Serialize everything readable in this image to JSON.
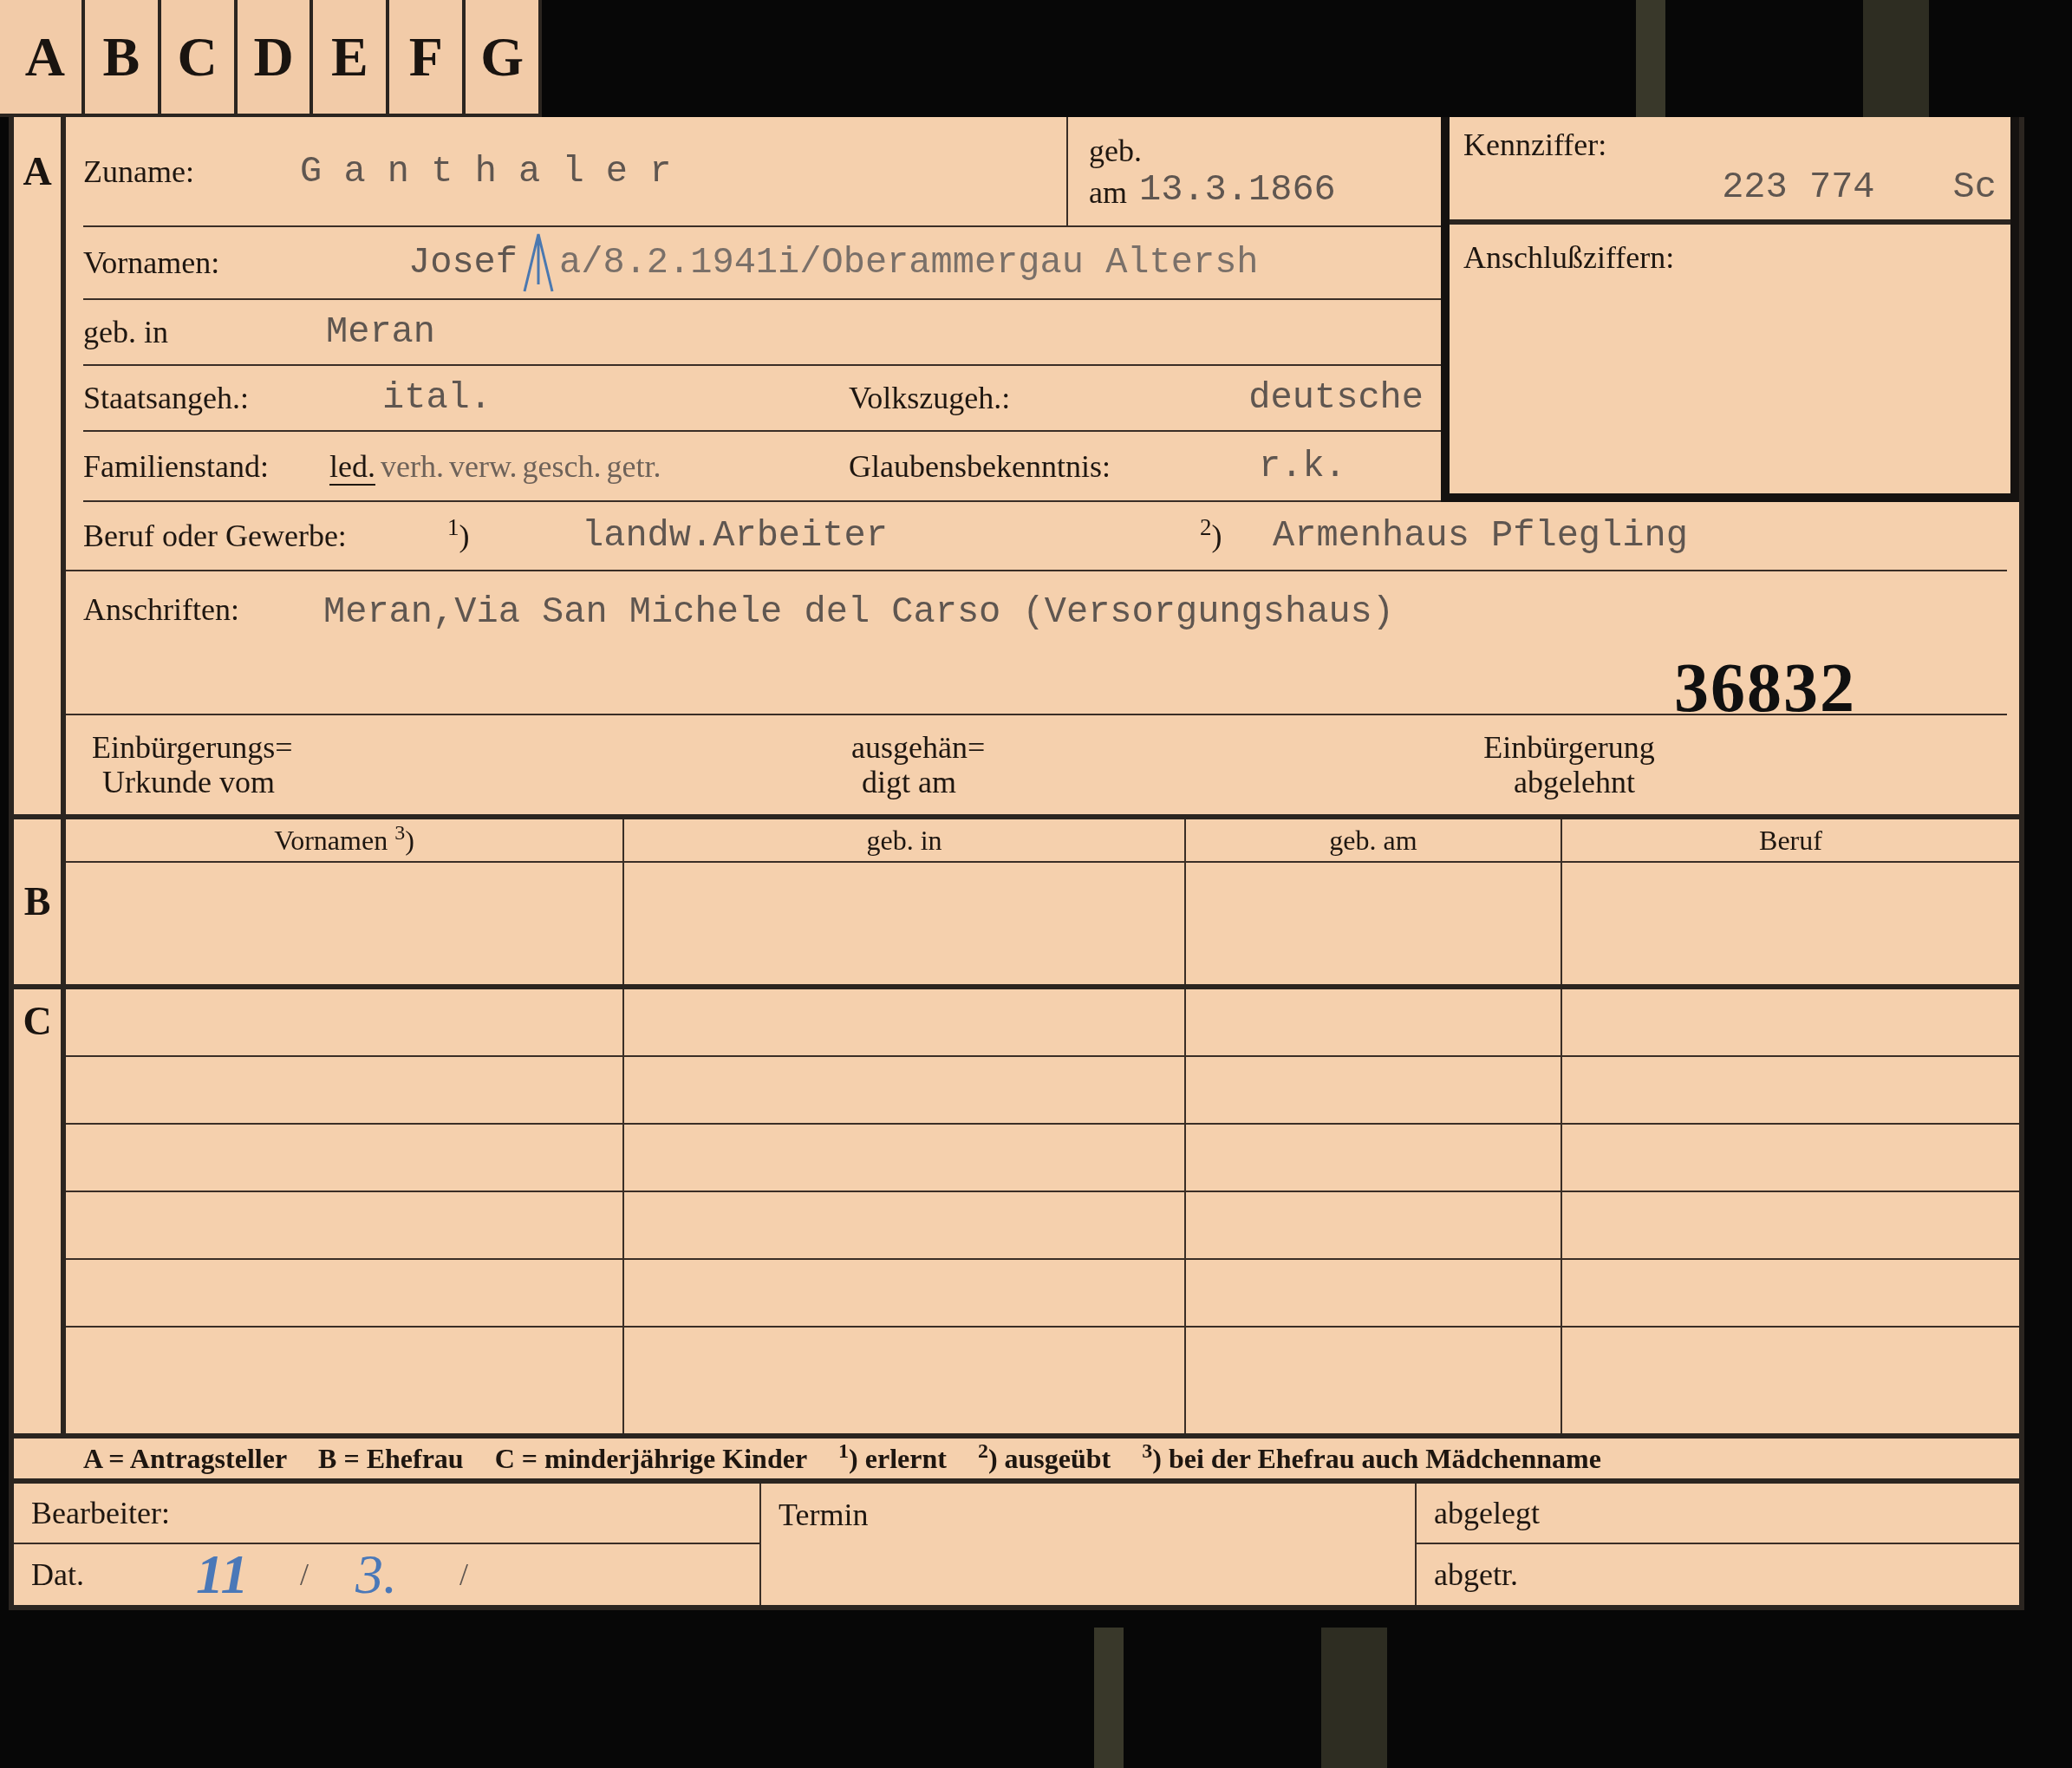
{
  "tabs": [
    {
      "label": "A"
    },
    {
      "label": "B"
    },
    {
      "label": "C"
    },
    {
      "label": "D"
    },
    {
      "label": "E"
    },
    {
      "label": "F"
    },
    {
      "label": "G"
    }
  ],
  "section_letters": [
    "A",
    "B",
    "C"
  ],
  "surname": {
    "label": "Zuname:",
    "value": "G a n t h a l e r"
  },
  "birth_date": {
    "label_1": "geb.",
    "label_2": "am",
    "value": "13.3.1866"
  },
  "identifier": {
    "label": "Kennziffer:",
    "value": "223 774",
    "suffix": "Sc"
  },
  "linked_numbers": {
    "label": "Anschlußziffern:"
  },
  "first_names": {
    "label": "Vornamen:",
    "value": "Josef",
    "note": "a/8.2.1941i/Oberammergau Altersh"
  },
  "birthplace": {
    "label": "geb. in",
    "value": "Meran"
  },
  "citizenship": {
    "label": "Staatsangeh.:",
    "value": "ital."
  },
  "ethnicity": {
    "label": "Volkszugeh.:",
    "value": "deutsche"
  },
  "marital_status": {
    "label": "Familienstand:",
    "options": [
      {
        "label": "led.",
        "selected": true
      },
      {
        "label": "verh.",
        "selected": false
      },
      {
        "label": "verw.",
        "selected": false
      },
      {
        "label": "gesch.",
        "selected": false
      },
      {
        "label": "getr.",
        "selected": false
      }
    ]
  },
  "religion": {
    "label": "Glaubensbekenntnis:",
    "value": "r.k."
  },
  "occupation": {
    "label": "Beruf oder Gewerbe:",
    "learned_mark": "$^{1}$)",
    "learned": "landw.Arbeiter",
    "practised_mark": "$^{2}$)",
    "practised": "Armenhaus Pflegling"
  },
  "address": {
    "label": "Anschriften:",
    "value": "Meran,Via San Michele del Carso (Versorgungshaus)"
  },
  "stamp_number": "36832",
  "naturalization": [
    {
      "line_1": "Einbürgerungs=",
      "line_2": "Urkunde vom"
    },
    {
      "line_1": "ausgehän=",
      "line_2": "digt am"
    },
    {
      "line_1": "Einbürgerung",
      "line_2": "abgelehnt"
    }
  ],
  "spouse_table": {
    "columns": [
      "Vornamen $^{3}$)",
      "geb. in",
      "geb. am",
      "Beruf"
    ]
  },
  "legend": [
    "A = Antragsteller",
    "B = Ehefrau",
    "C = minderjährige Kinder",
    "$^{1}$) erlernt",
    "$^{2}$) ausgeübt",
    "$^{3}$) bei der Ehefrau auch Mädchenname"
  ],
  "footer": {
    "clerk_label": "Bearbeiter:",
    "date_label": "Dat.",
    "date_day": "11",
    "date_sep_1": "/",
    "date_month": "3.",
    "date_sep_2": "/",
    "deadline_label": "Termin",
    "filed_label": "abgelegt",
    "separated_label": "abgetr."
  }
}
